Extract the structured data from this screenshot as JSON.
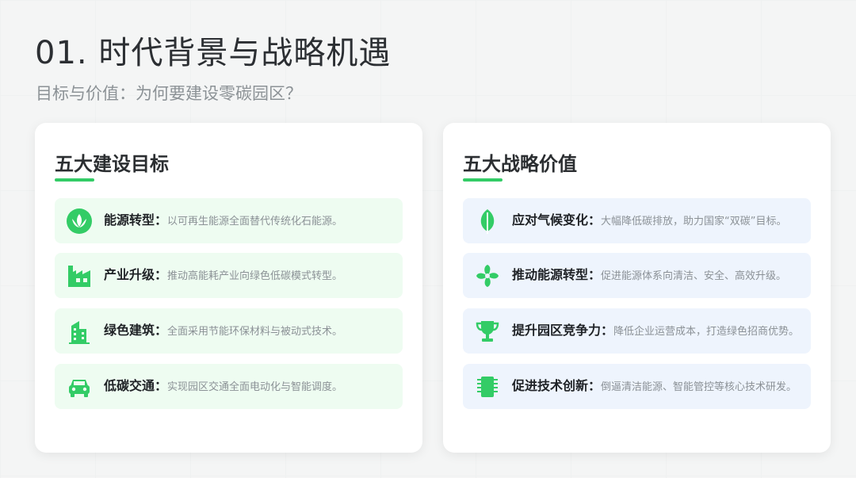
{
  "header": {
    "title": "01. 时代背景与战略机遇",
    "subtitle": "目标与价值：为何要建设零碳园区？"
  },
  "accent_color": "#33cc66",
  "left_card": {
    "title": "五大建设目标",
    "items": [
      {
        "icon": "lotus-icon",
        "key": "能源转型：",
        "desc": "以可再生能源全面替代传统化石能源。"
      },
      {
        "icon": "factory-icon",
        "key": "产业升级：",
        "desc": "推动高能耗产业向绿色低碳模式转型。"
      },
      {
        "icon": "building-icon",
        "key": "绿色建筑：",
        "desc": "全面采用节能环保材料与被动式技术。"
      },
      {
        "icon": "car-icon",
        "key": "低碳交通：",
        "desc": "实现园区交通全面电动化与智能调度。"
      }
    ]
  },
  "right_card": {
    "title": "五大战略价值",
    "items": [
      {
        "icon": "leaf-icon",
        "key": "应对气候变化：",
        "desc": "大幅降低碳排放，助力国家“双碳”目标。"
      },
      {
        "icon": "fan-icon",
        "key": "推动能源转型：",
        "desc": "促进能源体系向清洁、安全、高效升级。"
      },
      {
        "icon": "trophy-icon",
        "key": "提升园区竞争力：",
        "desc": "降低企业运营成本，打造绿色招商优势。"
      },
      {
        "icon": "chip-icon",
        "key": "促进技术创新：",
        "desc": "倒逼清洁能源、智能管控等核心技术研发。"
      }
    ]
  }
}
